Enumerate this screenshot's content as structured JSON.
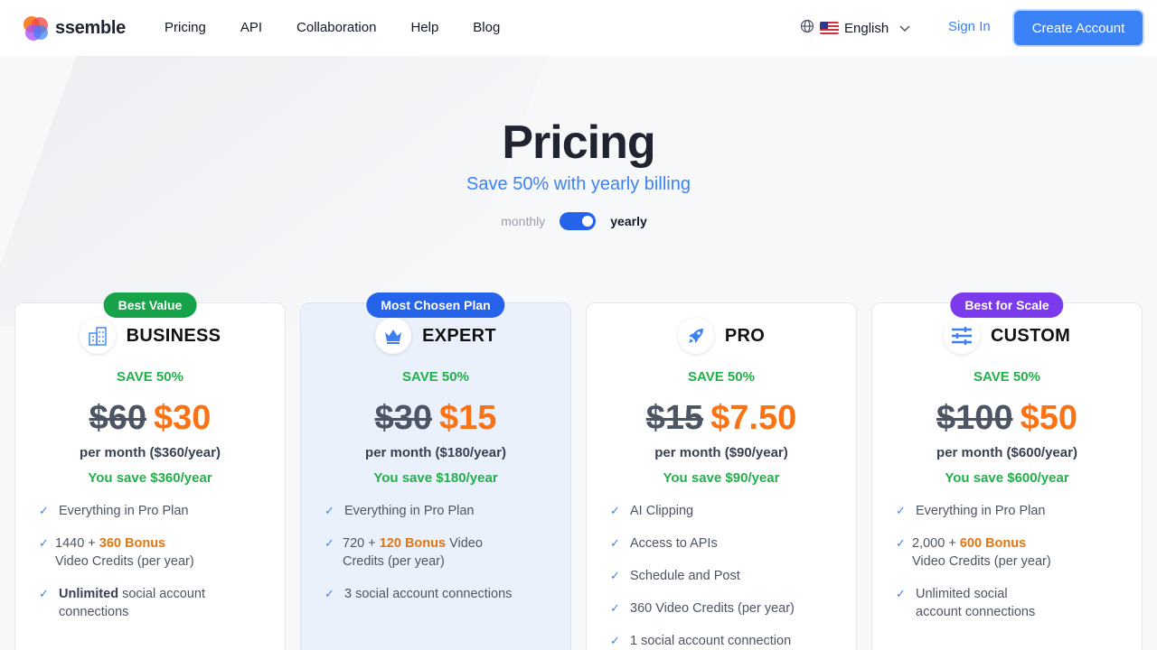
{
  "header": {
    "logo_text": "ssemble",
    "nav": [
      "Pricing",
      "API",
      "Collaboration",
      "Help",
      "Blog"
    ],
    "language": "English",
    "sign_in": "Sign In",
    "create_account": "Create Account"
  },
  "hero": {
    "title": "Pricing",
    "subtitle": "Save 50% with yearly billing",
    "toggle_left": "monthly",
    "toggle_right": "yearly",
    "toggle_state": "yearly"
  },
  "plans": [
    {
      "badge": "Best Value",
      "badge_color": "#16a34a",
      "icon": "building-icon",
      "name": "BUSINESS",
      "save": "SAVE 50%",
      "old_price": "$60",
      "new_price": "$30",
      "per": "per month ($360/year)",
      "you_save": "You save $360/year",
      "features": [
        "Everything in Pro Plan",
        "1440 + ",
        "360 Bonus",
        "Video Credits (per year)",
        "Unlimited",
        " social account connections"
      ]
    },
    {
      "badge": "Most Chosen Plan",
      "badge_color": "#2563eb",
      "icon": "crown-icon",
      "name": "EXPERT",
      "save": "SAVE 50%",
      "old_price": "$30",
      "new_price": "$15",
      "per": "per month ($180/year)",
      "you_save": "You save $180/year",
      "features": [
        "Everything in Pro Plan",
        "720 + ",
        "120 Bonus",
        " Video Credits (per year)",
        "3 social account connections"
      ]
    },
    {
      "badge": "",
      "icon": "rocket-icon",
      "name": "PRO",
      "save": "SAVE 50%",
      "old_price": "$15",
      "new_price": "$7.50",
      "per": "per month ($90/year)",
      "you_save": "You save $90/year",
      "features": [
        "AI Clipping",
        "Access to APIs",
        "Schedule and Post",
        "360 Video Credits (per year)",
        "1 social account connection"
      ]
    },
    {
      "badge": "Best for Scale",
      "badge_color": "#7c3aed",
      "icon": "sliders-icon",
      "name": "CUSTOM",
      "save": "SAVE 50%",
      "old_price": "$100",
      "new_price": "$50",
      "per": "per month ($600/year)",
      "you_save": "You save $600/year",
      "features": [
        "Everything in Pro Plan",
        "2,000 + ",
        "600 Bonus",
        "Video Credits (per year)",
        "Unlimited social account connections"
      ]
    }
  ]
}
